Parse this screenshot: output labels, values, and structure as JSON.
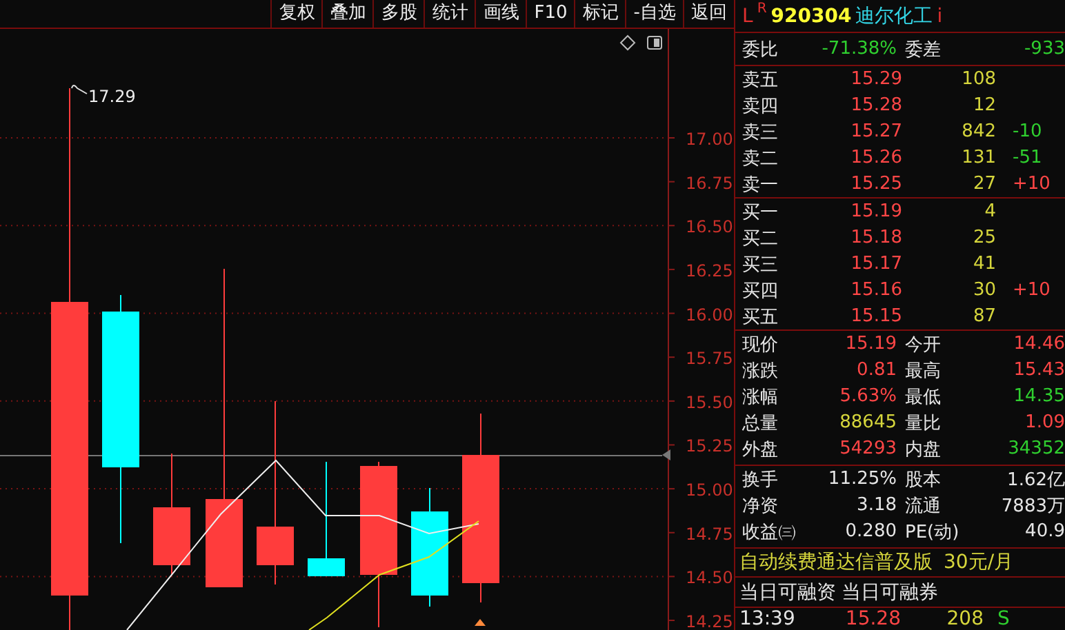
{
  "toolbar": {
    "buttons": [
      "复权",
      "叠加",
      "多股",
      "统计",
      "画线",
      "F10",
      "标记",
      "-自选",
      "返回"
    ]
  },
  "chart": {
    "high_label": "17.29",
    "y_axis_labels": [
      "17.00",
      "16.75",
      "16.50",
      "16.25",
      "16.00",
      "15.75",
      "15.50",
      "15.25",
      "15.00",
      "14.75",
      "14.50",
      "14.25"
    ]
  },
  "quote": {
    "market_tag": "L",
    "badge": "R",
    "code": "920304",
    "name": "迪尔化工",
    "info_mark": "i",
    "ratio": [
      {
        "label": "委比",
        "value": "-71.38%",
        "color": "#2fcf2f"
      },
      {
        "label": "委差",
        "value": "-933",
        "color": "#2fcf2f"
      }
    ],
    "asks": [
      {
        "label": "卖五",
        "price": "15.29",
        "volume": "108"
      },
      {
        "label": "卖四",
        "price": "15.28",
        "volume": "12"
      },
      {
        "label": "卖三",
        "price": "15.27",
        "volume": "842",
        "change": "-10",
        "color": "#2fcf2f"
      },
      {
        "label": "卖二",
        "price": "15.26",
        "volume": "131",
        "change": "-51",
        "color": "#2fcf2f"
      },
      {
        "label": "卖一",
        "price": "15.25",
        "volume": "27",
        "change": "+10",
        "color": "#ff4646"
      }
    ],
    "bids": [
      {
        "label": "买一",
        "price": "15.19",
        "volume": "4"
      },
      {
        "label": "买二",
        "price": "15.18",
        "volume": "25"
      },
      {
        "label": "买三",
        "price": "15.17",
        "volume": "41"
      },
      {
        "label": "买四",
        "price": "15.16",
        "volume": "30",
        "change": "+10",
        "color": "#ff4646"
      },
      {
        "label": "买五",
        "price": "15.15",
        "volume": "87"
      }
    ],
    "stats": [
      [
        {
          "label": "现价",
          "value": "15.19",
          "color": "#ff4646"
        },
        {
          "label": "今开",
          "value": "14.46",
          "color": "#ff4646"
        }
      ],
      [
        {
          "label": "涨跌",
          "value": "0.81",
          "color": "#ff4646"
        },
        {
          "label": "最高",
          "value": "15.43",
          "color": "#ff4646"
        }
      ],
      [
        {
          "label": "涨幅",
          "value": "5.63%",
          "color": "#ff4646"
        },
        {
          "label": "最低",
          "value": "14.35",
          "color": "#2fcf2f"
        }
      ],
      [
        {
          "label": "总量",
          "value": "88645",
          "color": "#d6d63c"
        },
        {
          "label": "量比",
          "value": "1.09",
          "color": "#ff4646"
        }
      ],
      [
        {
          "label": "外盘",
          "value": "54293",
          "color": "#ff4646"
        },
        {
          "label": "内盘",
          "value": "34352",
          "color": "#2fcf2f"
        }
      ]
    ],
    "fundamentals": [
      [
        {
          "label": "换手",
          "value": "11.25%"
        },
        {
          "label": "股本",
          "value": "1.62亿"
        }
      ],
      [
        {
          "label": "净资",
          "value": "3.18"
        },
        {
          "label": "流通",
          "value": "7883万"
        }
      ],
      [
        {
          "label": "收益㈢",
          "value": "0.280"
        },
        {
          "label": "PE(动)",
          "value": "40.9"
        }
      ]
    ],
    "promo": {
      "text": "自动续费通达信普及版",
      "price": "30元/月"
    },
    "margin_links": [
      "当日可融资",
      "当日可融券"
    ],
    "last_trade": {
      "time": "13:39",
      "price": "15.28",
      "volume": "208",
      "side": "S"
    }
  }
}
